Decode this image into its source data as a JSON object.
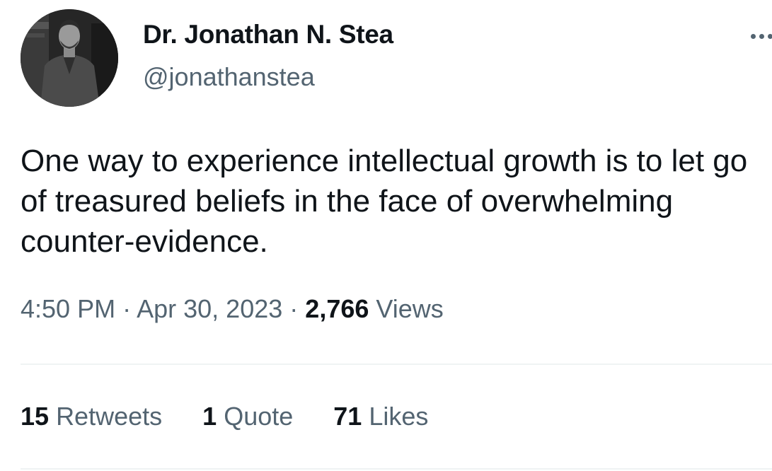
{
  "author": {
    "display_name": "Dr. Jonathan N. Stea",
    "handle": "@jonathanstea"
  },
  "tweet": {
    "text": "One way to experience intellectual growth is to let go of treasured beliefs in the face of overwhelming counter-evidence.",
    "time": "4:50 PM",
    "separator": "·",
    "date": "Apr 30, 2023",
    "views_count": "2,766",
    "views_label": "Views"
  },
  "stats": {
    "retweets_count": "15",
    "retweets_label": "Retweets",
    "quotes_count": "1",
    "quotes_label": "Quote",
    "likes_count": "71",
    "likes_label": "Likes"
  },
  "icons": {
    "more": "more-horizontal-icon",
    "avatar": "profile-photo"
  },
  "colors": {
    "text_primary": "#0f1419",
    "text_secondary": "#536471",
    "divider": "#eff3f4"
  }
}
